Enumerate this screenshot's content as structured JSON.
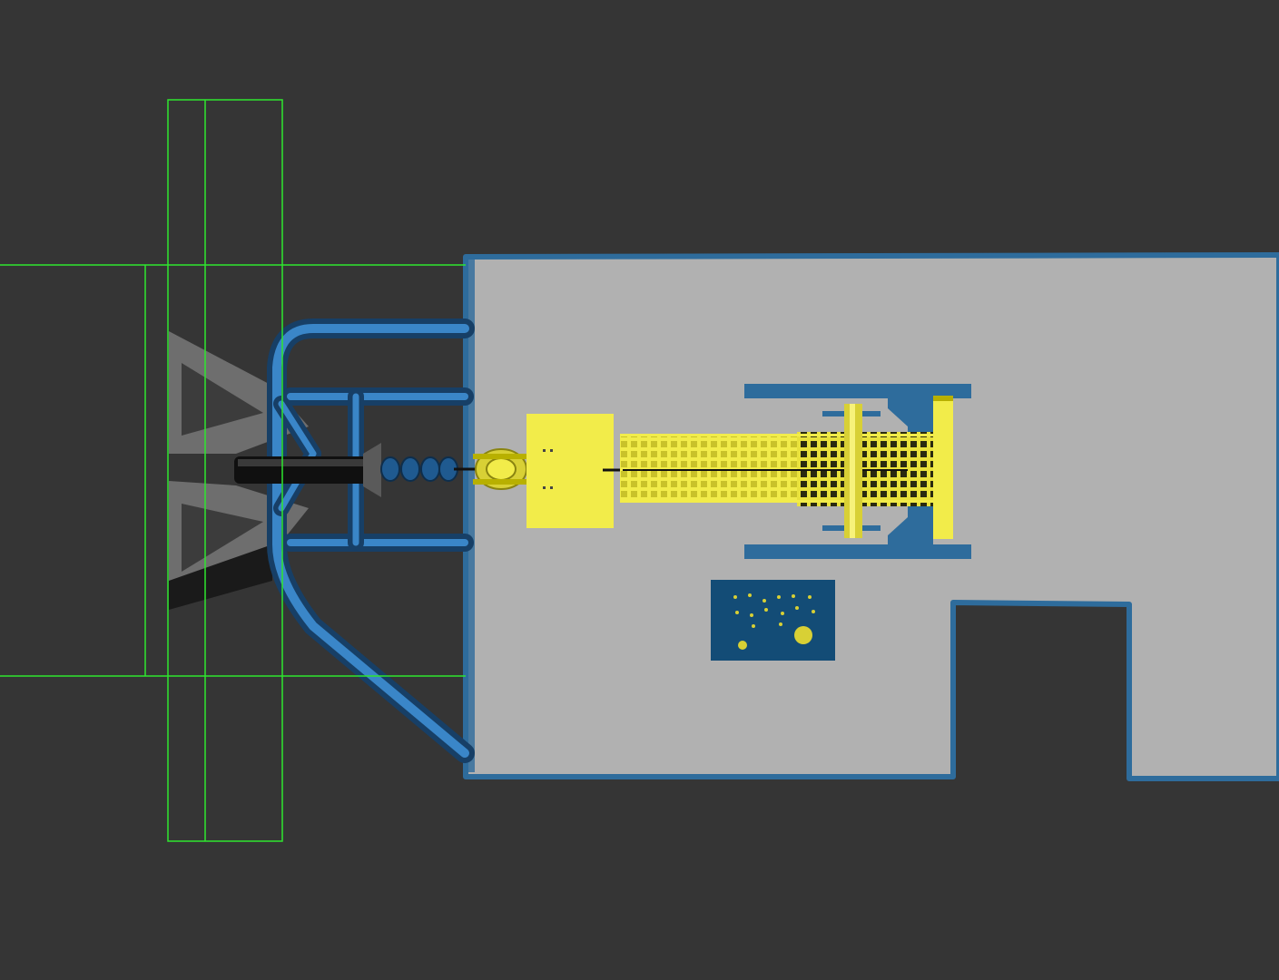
{
  "viewport": {
    "label": "",
    "background": "#353535"
  },
  "colors": {
    "floor": "#b1b1b1",
    "floor_edge": "#2e6c9c",
    "pipe": "#24609a",
    "pipe_highlight": "#3a86c8",
    "selection_wire": "#2ee62e",
    "yellow": "#f2ec4a",
    "yellow_dark": "#b8b000",
    "screen": "#134c76",
    "dark_metal": "#1e1e1e",
    "grey_metal": "#8c8c8c"
  },
  "objects": [
    {
      "name": "floor-slab",
      "kind": "platform"
    },
    {
      "name": "pipe-frame",
      "kind": "tubular-frame"
    },
    {
      "name": "selection-bounding-box",
      "kind": "wireframe",
      "selected": true
    },
    {
      "name": "gripper-tool",
      "kind": "end-effector"
    },
    {
      "name": "carriage",
      "kind": "machine"
    },
    {
      "name": "control-panel",
      "kind": "panel"
    }
  ]
}
